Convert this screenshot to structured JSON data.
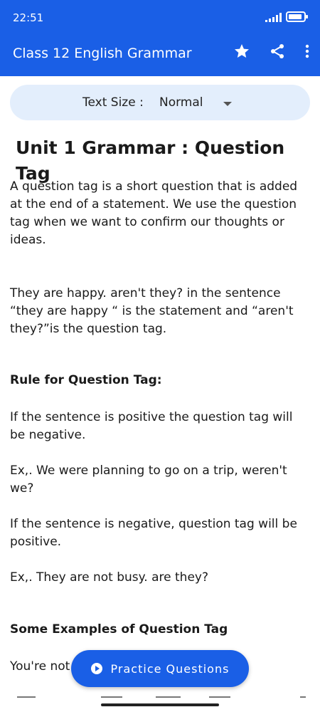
{
  "status_bar": {
    "time": "22:51"
  },
  "app_bar": {
    "title": "Class 12 English Grammar",
    "actions": [
      "star-icon",
      "share-icon",
      "more-vert-icon"
    ]
  },
  "text_size": {
    "label": "Text Size :",
    "value": "Normal"
  },
  "article": {
    "title": "Unit 1 Grammar : Question Tag",
    "intro": "A question tag is a short question that is added at the end of a statement. We use the question tag when we want to confirm our thoughts or ideas.",
    "example_intro": "They are happy. aren't they? in the sentence “they are happy “ is the statement and “aren't they?”is the question tag.",
    "rule_heading": "Rule for Question Tag:",
    "rule_positive": "If the sentence is positive the question tag will be negative.",
    "ex_positive": "Ex,. We were planning to go on a trip, weren't we?",
    "rule_negative": "If the sentence is negative, question tag will be positive.",
    "ex_negative": "Ex,. They are not busy. are they?",
    "examples_heading": "Some Examples of Question Tag",
    "example_1": "You're not"
  },
  "fab": {
    "label": "Practice Questions"
  },
  "colors": {
    "primary": "#1a5fe6",
    "surface": "#e3eefc",
    "text": "#1a1a1a"
  }
}
